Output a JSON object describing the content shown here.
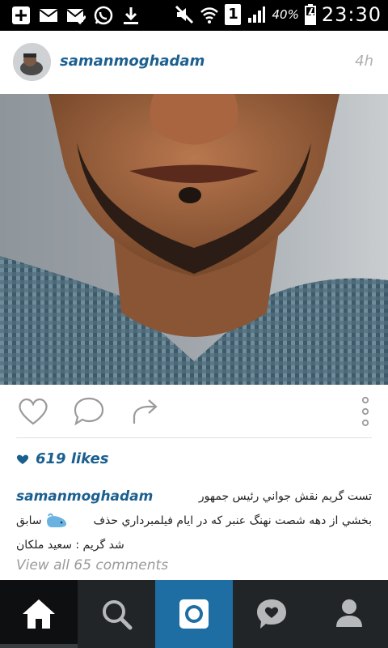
{
  "status_bar": {
    "battery_pct": "40%",
    "sim_badge": "1",
    "time": "23:30",
    "icons": [
      "add-icon",
      "mail-icon",
      "mail-check-icon",
      "whatsapp-icon",
      "download-icon",
      "mute-icon",
      "wifi-icon",
      "sim-icon",
      "signal-icon",
      "battery-icon"
    ]
  },
  "post": {
    "username": "samanmoghadam",
    "time_ago": "4h",
    "likes": "619 likes",
    "caption": {
      "user": "samanmoghadam",
      "line1": "تست گريم نقش جواني رئيس جمهور",
      "line2_left": "سابق",
      "line2_right": "بخشي از دهه شصت نهنگ عنبر كه در ايام فيلمبرداري حذف",
      "line3": "شد گريم : سعيد ملكان"
    },
    "view_all": "View all 65 comments"
  },
  "colors": {
    "link_blue": "#1b5f8f",
    "nav_bg": "#222528",
    "nav_active_camera": "#1f6ea3"
  },
  "nav": [
    "home-icon",
    "search-icon",
    "camera-icon",
    "activity-heart-icon",
    "profile-icon"
  ]
}
